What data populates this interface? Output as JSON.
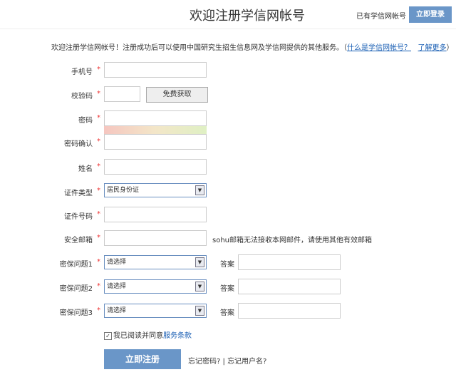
{
  "header": {
    "title": "欢迎注册学信网帐号",
    "have_account": "已有学信网帐号",
    "login_button": "立即登录"
  },
  "intro": {
    "text": "欢迎注册学信网帐号！注册成功后可以使用中国研究生招生信息网及学信网提供的其他服务。（",
    "link1": "什么是学信网帐号？",
    "link2": "了解更多",
    "close": "）"
  },
  "form": {
    "star": "*",
    "phone": "手机号",
    "captcha": "校验码",
    "get_code": "免费获取",
    "password": "密码",
    "confirm": "密码确认",
    "name": "姓名",
    "id_type": "证件类型",
    "id_type_value": "居民身份证",
    "id_number": "证件号码",
    "email": "安全邮箱",
    "email_hint": "sohu邮箱无法接收本网邮件，请使用其他有效邮箱",
    "q1": "密保问题1",
    "q2": "密保问题2",
    "q3": "密保问题3",
    "select_placeholder": "请选择",
    "answer": "答案",
    "agree_text": "我已阅读并同意",
    "terms": "服务条款",
    "agree_checked": true,
    "register": "立即注册",
    "forgot_password": "忘记密码?",
    "divider": "|",
    "forgot_username": "忘记用户名?"
  }
}
